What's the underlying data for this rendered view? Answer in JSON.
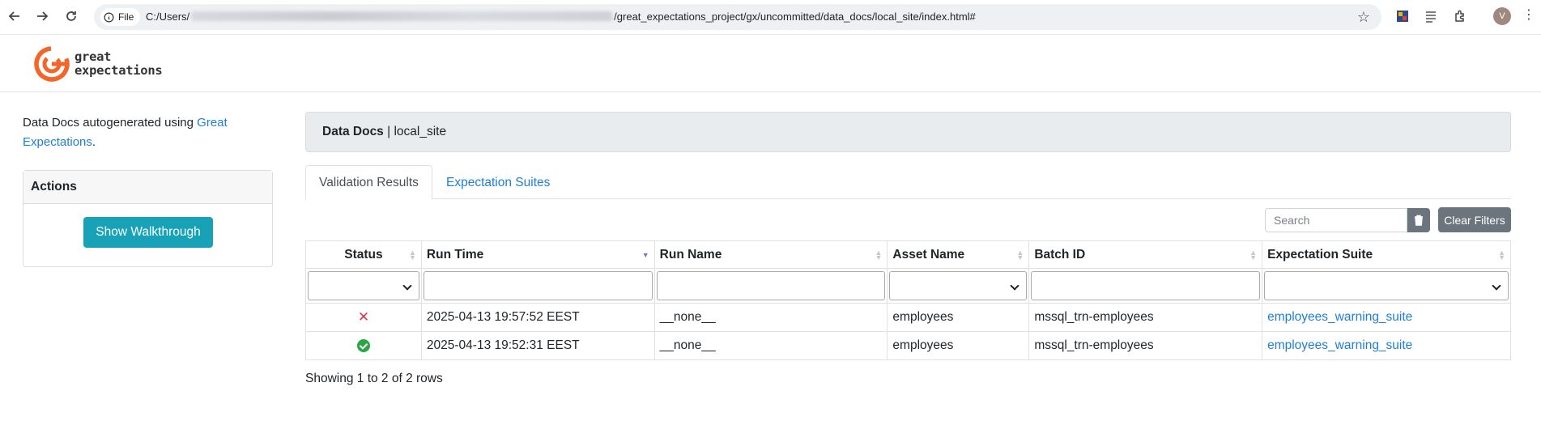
{
  "browser": {
    "site_info_label": "File",
    "url_prefix": "C:/Users/",
    "url_suffix": "/great_expectations_project/gx/uncommitted/data_docs/local_site/index.html#",
    "profile_initial": "V"
  },
  "header": {
    "logo_line1": "great",
    "logo_line2": "expectations",
    "brand_color": "#f2662a"
  },
  "sidebar": {
    "intro_text": "Data Docs autogenerated using ",
    "intro_link": "Great Expectations",
    "intro_end": ".",
    "actions_title": "Actions",
    "walkthrough_label": "Show Walkthrough"
  },
  "main": {
    "crumb_title": "Data Docs",
    "crumb_separator": " | ",
    "crumb_site": "local_site",
    "tabs": [
      {
        "label": "Validation Results",
        "active": true
      },
      {
        "label": "Expectation Suites",
        "active": false
      }
    ],
    "search_placeholder": "Search",
    "clear_filters_label": "Clear Filters",
    "columns": [
      "Status",
      "Run Time",
      "Run Name",
      "Asset Name",
      "Batch ID",
      "Expectation Suite"
    ],
    "rows": [
      {
        "status": "failed",
        "run_time": "2025-04-13 19:57:52 EEST",
        "run_name": "__none__",
        "asset_name": "employees",
        "batch_id": "mssql_trn-employees",
        "suite": "employees_warning_suite"
      },
      {
        "status": "success",
        "run_time": "2025-04-13 19:52:31 EEST",
        "run_name": "__none__",
        "asset_name": "employees",
        "batch_id": "mssql_trn-employees",
        "suite": "employees_warning_suite"
      }
    ],
    "pagination_text": "Showing 1 to 2 of 2 rows"
  }
}
